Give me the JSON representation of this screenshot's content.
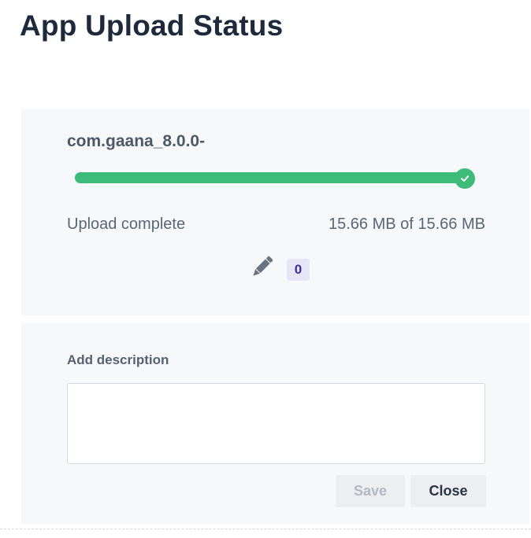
{
  "page": {
    "title": "App Upload Status"
  },
  "upload": {
    "file_name": "com.gaana_8.0.0-",
    "progress_fraction": 1.0,
    "status": "Upload complete",
    "size_text": "15.66 MB of 15.66 MB",
    "edit_count": "0",
    "colors": {
      "progress": "#3dbb79",
      "badge_bg": "#e8e5f7",
      "badge_text": "#3e2e9c"
    },
    "icons": {
      "complete": "check-icon",
      "edit": "pencil-icon"
    }
  },
  "description": {
    "label": "Add description",
    "value": "",
    "save_label": "Save",
    "close_label": "Close"
  }
}
